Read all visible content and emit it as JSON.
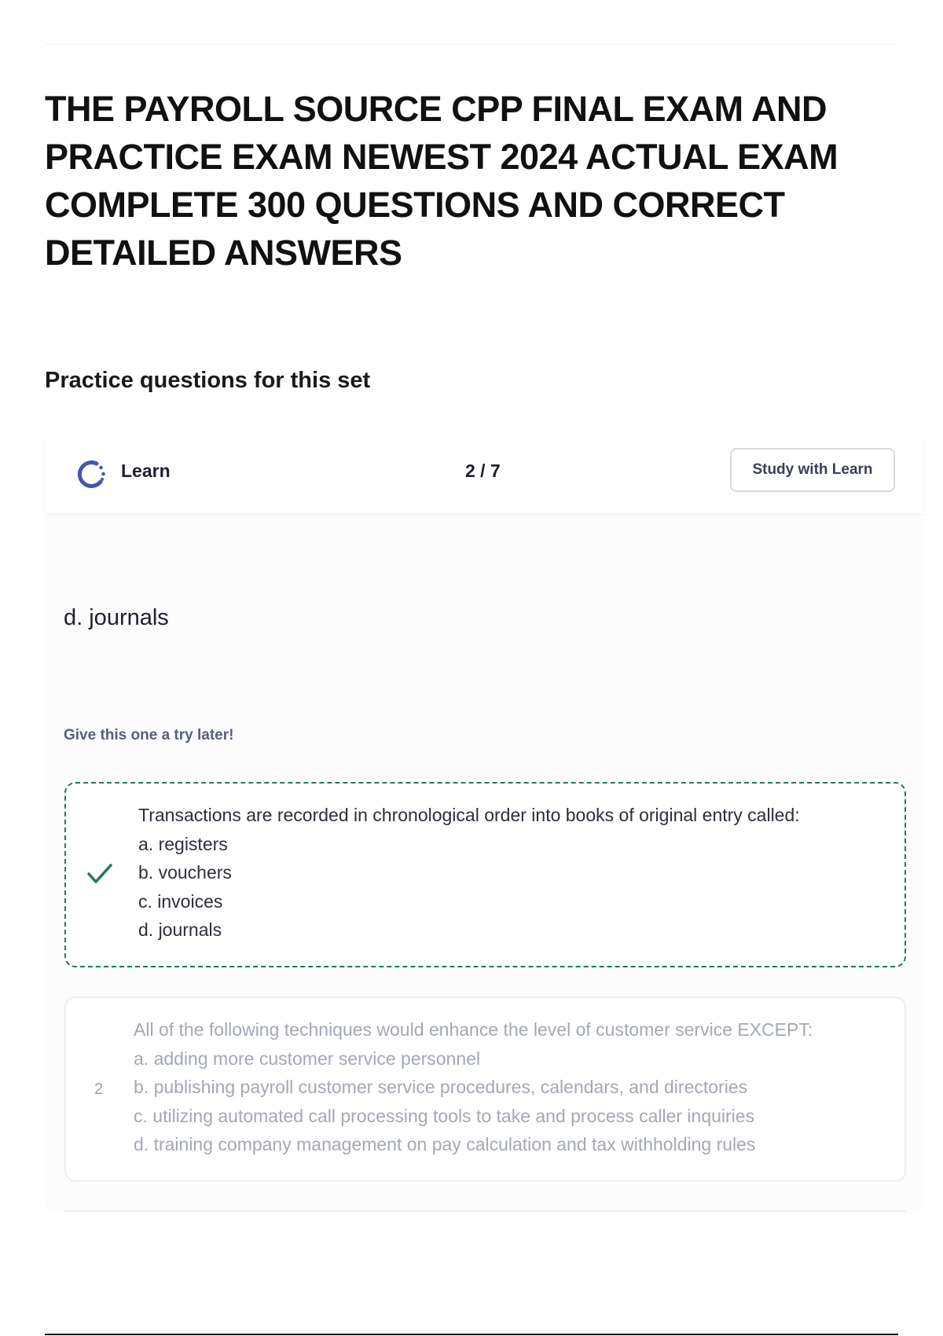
{
  "document": {
    "title": "THE PAYROLL SOURCE CPP FINAL EXAM AND PRACTICE EXAM NEWEST 2024 ACTUAL EXAM COMPLETE 300 QUESTIONS AND CORRECT DETAILED ANSWERS",
    "section_heading": "Practice questions for this set"
  },
  "learn": {
    "label": "Learn",
    "icon": "learn-progress-icon",
    "progress": "2 / 7",
    "study_button_label": "Study with Learn",
    "current_answer": "d. journals",
    "hint": "Give this one a try later!"
  },
  "questions": [
    {
      "marker_icon": "check-icon",
      "prompt": "Transactions are recorded in chronological order into books of original entry called:",
      "options": [
        "a. registers",
        "b. vouchers",
        "c. invoices",
        "d. journals"
      ]
    },
    {
      "number": "2",
      "prompt": "All of the following techniques would enhance the level of customer service EXCEPT:",
      "options": [
        "a. adding more customer service personnel",
        "b. publishing payroll customer service procedures, calendars, and directories",
        "c. utilizing automated call processing tools to take and process caller inquiries",
        "d. training company management on pay calculation and tax withholding rules"
      ]
    }
  ],
  "colors": {
    "accent_blue": "#4257b2",
    "success_green": "#1f7a5a",
    "muted_text": "#a3a8b3"
  }
}
